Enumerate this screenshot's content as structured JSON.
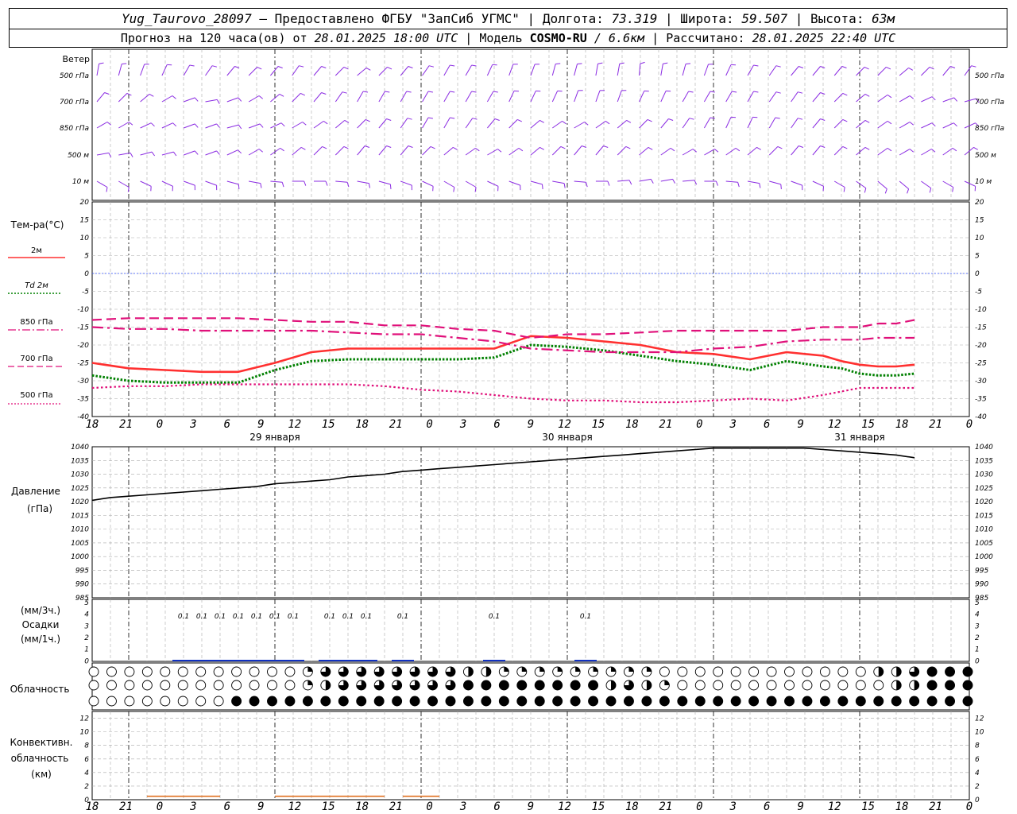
{
  "header": {
    "station": "Yug_Taurovo_28097",
    "provided_by": "– Предоставлено ФГБУ \"ЗапСиб УГМС\"",
    "lon_label": "Долгота:",
    "lon_value": "73.319",
    "lat_label": "Широта:",
    "lat_value": "59.507",
    "alt_label": "Высота:",
    "alt_value": "63м",
    "forecast_label": "Прогноз на 120 часа(ов) от",
    "forecast_start": "28.01.2025 18:00 UTC",
    "model_label": "Модель",
    "model_name": "COSMO-RU",
    "model_res": "/ 6.6км",
    "calc_label": "Рассчитано:",
    "calc_time": "28.01.2025 22:40 UTC"
  },
  "wind_panel": {
    "title": "Ветер",
    "levels": [
      "500 гПа",
      "700 гПа",
      "850 гПа",
      "500 м",
      "10  м"
    ]
  },
  "temp_panel": {
    "title": "Тем-ра(°C)",
    "legend": [
      {
        "label": "2м",
        "color": "#ff3030",
        "style": "solid"
      },
      {
        "label": "Td  2м",
        "color": "#008000",
        "style": "dotted"
      },
      {
        "label": "850 гПа",
        "color": "#e0107a",
        "style": "dashdot"
      },
      {
        "label": "700 гПа",
        "color": "#e0107a",
        "style": "dash"
      },
      {
        "label": "500 гПа",
        "color": "#e0107a",
        "style": "dot"
      }
    ]
  },
  "pressure_panel": {
    "title": "Давление",
    "unit": "(гПа)"
  },
  "precip_panel": {
    "unit_top": "(мм/3ч.)",
    "title": "Осадки",
    "unit_bottom": "(мм/1ч.)"
  },
  "cloud_panel": {
    "title": "Облачность"
  },
  "conv_panel": {
    "title_line1": "Конвективн.",
    "title_line2": "облачность",
    "unit": "(км)"
  },
  "x_axis": {
    "ticks": [
      "18",
      "21",
      "0",
      "3",
      "6",
      "9",
      "12",
      "15",
      "18",
      "21",
      "0",
      "3",
      "6",
      "9",
      "12",
      "15",
      "18",
      "21",
      "0",
      "3",
      "6",
      "9",
      "12",
      "15",
      "18",
      "21",
      "0"
    ],
    "dates": [
      "29 января",
      "30 января",
      "31 января"
    ]
  },
  "chart_data": [
    {
      "type": "line",
      "title": "Тем-ра(°C)",
      "x_hours": [
        0,
        6,
        12,
        18,
        24,
        30,
        36,
        42,
        48,
        54,
        60,
        66,
        72,
        78,
        84,
        90,
        96,
        102,
        108,
        114,
        120
      ],
      "ylim": [
        -40,
        20
      ],
      "y_ticks": [
        20,
        15,
        10,
        5,
        0,
        -5,
        -10,
        -15,
        -20,
        -25,
        -30,
        -35,
        -40
      ],
      "series": [
        {
          "name": "2м",
          "values": [
            -25,
            -26.5,
            -27,
            -27.5,
            -27.5,
            -25,
            -22,
            -21,
            -21,
            -21,
            -21,
            -21,
            -17.5,
            -18,
            -19,
            -20,
            -22,
            -22.5,
            -24,
            -22,
            -23
          ]
        },
        {
          "name": "Td  2м",
          "values": [
            -28.5,
            -30,
            -30.5,
            -30.5,
            -30.5,
            -27,
            -24.5,
            -24,
            -24,
            -24,
            -24,
            -23.5,
            -20,
            -20.5,
            -21.5,
            -23,
            -24.5,
            -25.5,
            -27,
            -24.5,
            -26
          ]
        },
        {
          "name": "850 гПа",
          "values": [
            -15,
            -15.5,
            -15.5,
            -16,
            -16,
            -16,
            -16,
            -16.5,
            -17,
            -17,
            -18,
            -19,
            -21,
            -21.5,
            -22,
            -22,
            -22,
            -21,
            -20.5,
            -19,
            -18.5
          ]
        },
        {
          "name": "700 гПа",
          "values": [
            -13,
            -12.5,
            -12.5,
            -12.5,
            -12.5,
            -13,
            -13.5,
            -13.5,
            -14.5,
            -14.5,
            -15.5,
            -16,
            -18,
            -17,
            -17,
            -16.5,
            -16,
            -16,
            -16,
            -16,
            -15
          ]
        },
        {
          "name": "500 гПа",
          "values": [
            -32,
            -31.5,
            -31.5,
            -31,
            -31,
            -31,
            -31,
            -31,
            -31.5,
            -32.5,
            -33,
            -34,
            -35,
            -35.5,
            -35.5,
            -36,
            -36,
            -35.5,
            -35,
            -35.5,
            -34
          ]
        }
      ],
      "zero_line": 0,
      "more_points_hours": [
        123,
        126,
        129,
        132,
        135
      ],
      "more_points": {
        "2м": [
          -24.5,
          -25.5,
          -26,
          -26,
          -25.5
        ],
        "Td  2м": [
          -26.5,
          -28,
          -28.5,
          -28.5,
          -28
        ],
        "850 гПа": [
          -18.5,
          -18.5,
          -18,
          -18,
          -18
        ],
        "700 гПа": [
          -15,
          -15,
          -14,
          -14,
          -13
        ],
        "500 гПа": [
          -33,
          -32,
          -32,
          -32,
          -32
        ]
      }
    },
    {
      "type": "line",
      "title": "Давление",
      "x_hours": [
        0,
        3,
        6,
        9,
        12,
        15,
        18,
        21,
        24,
        27,
        30,
        33,
        36,
        39,
        42,
        45,
        48,
        51,
        54,
        57,
        60,
        63,
        66,
        69,
        72,
        75,
        78,
        81,
        84,
        87,
        90,
        93,
        96,
        99,
        102,
        105,
        108,
        111,
        114,
        117,
        120,
        123,
        126,
        129,
        132,
        135
      ],
      "ylim": [
        985,
        1040
      ],
      "y_ticks": [
        1040,
        1035,
        1030,
        1025,
        1020,
        1015,
        1010,
        1005,
        1000,
        995,
        990,
        985
      ],
      "series": [
        {
          "name": "",
          "values": [
            1020.5,
            1021.5,
            1022,
            1022.5,
            1023,
            1023.5,
            1024,
            1024.5,
            1025,
            1025.5,
            1026.5,
            1027,
            1027.5,
            1028,
            1029,
            1029.5,
            1030,
            1031,
            1031.5,
            1032,
            1032.5,
            1033,
            1033.5,
            1034,
            1034.5,
            1035,
            1035.5,
            1036,
            1036.5,
            1037,
            1037.5,
            1038,
            1038.5,
            1039,
            1039.5,
            1039.5,
            1039.5,
            1039.5,
            1039.5,
            1039.5,
            1039,
            1038.5,
            1038,
            1037.5,
            1037,
            1036
          ]
        }
      ]
    },
    {
      "type": "bar",
      "title": "Осадки",
      "ylim": [
        0,
        5
      ],
      "y_ticks": [
        5,
        4,
        3,
        2,
        1,
        0
      ],
      "annotations_hours": [
        15,
        18,
        21,
        24,
        27,
        30,
        33,
        39,
        42,
        45,
        51,
        66,
        81
      ],
      "annotation_label": "0.1"
    },
    {
      "type": "table",
      "title": "Облачность",
      "rows": 3,
      "columns": 41,
      "levels_fraction": {
        "top": [
          0,
          0,
          0,
          0,
          0,
          0,
          0,
          0,
          0,
          0,
          0,
          0,
          0.25,
          0.75,
          0.75,
          0.75,
          0.75,
          0.75,
          0.75,
          0.75,
          0.75,
          0.5,
          0.5,
          0.25,
          0.25,
          0.25,
          0.25,
          0.25,
          0.25,
          0.25,
          0.25,
          0.25,
          0,
          0,
          0,
          0,
          0,
          0,
          0,
          0,
          0,
          0,
          0,
          0,
          0.5,
          0.5,
          0.75,
          1,
          1,
          1
        ],
        "middle": [
          0,
          0,
          0,
          0,
          0,
          0,
          0,
          0,
          0,
          0,
          0,
          0,
          0.25,
          0.5,
          0.75,
          0.75,
          0.75,
          0.75,
          0.75,
          0.75,
          0.75,
          1,
          1,
          1,
          1,
          1,
          1,
          1,
          1,
          0.5,
          0.75,
          0.5,
          0.25,
          0,
          0,
          0,
          0,
          0,
          0,
          0,
          0,
          0,
          0,
          0,
          0,
          0.5,
          0.5,
          1,
          1,
          1
        ],
        "bottom": [
          0,
          0,
          0,
          0,
          0,
          0,
          0,
          0,
          1,
          1,
          1,
          1,
          1,
          1,
          1,
          1,
          1,
          1,
          1,
          1,
          1,
          1,
          1,
          1,
          1,
          1,
          1,
          1,
          1,
          1,
          1,
          1,
          1,
          1,
          1,
          1,
          1,
          1,
          1,
          1,
          1,
          1,
          1,
          1,
          1,
          1,
          1,
          1,
          1,
          1
        ]
      }
    },
    {
      "type": "bar",
      "title": "Конвективн. облачность",
      "ylim": [
        0,
        13
      ],
      "y_ticks": [
        12,
        10,
        8,
        6,
        4,
        2,
        0
      ],
      "segments_hours": [
        [
          9,
          21
        ],
        [
          30,
          48
        ],
        [
          51,
          57
        ]
      ],
      "value_km": 0.5
    }
  ]
}
